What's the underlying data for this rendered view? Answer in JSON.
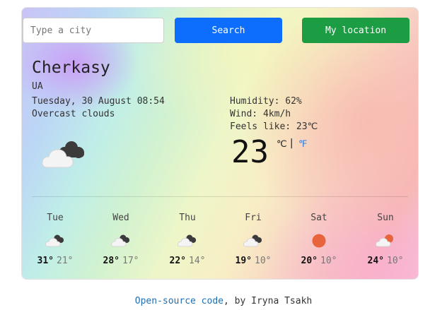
{
  "search": {
    "placeholder": "Type a city",
    "value": "",
    "search_label": "Search",
    "location_label": "My location"
  },
  "current": {
    "city": "Cherkasy",
    "country": "UA",
    "datetime": "Tuesday, 30 August 08:54",
    "description": "Overcast clouds",
    "icon": "overcast-clouds-icon",
    "humidity": "Humidity: 62%",
    "wind": "Wind: 4km/h",
    "feels_like": "Feels like: 23℃",
    "temperature": "23",
    "unit_celsius": "℃",
    "unit_separator": "|",
    "unit_fahrenheit": "℉"
  },
  "forecast": [
    {
      "day": "Tue",
      "max": "31°",
      "min": "21°",
      "icon": "broken-clouds-icon"
    },
    {
      "day": "Wed",
      "max": "28°",
      "min": "17°",
      "icon": "broken-clouds-icon"
    },
    {
      "day": "Thu",
      "max": "22°",
      "min": "14°",
      "icon": "broken-clouds-icon"
    },
    {
      "day": "Fri",
      "max": "19°",
      "min": "10°",
      "icon": "broken-clouds-icon"
    },
    {
      "day": "Sat",
      "max": "20°",
      "min": "10°",
      "icon": "sun-icon"
    },
    {
      "day": "Sun",
      "max": "24°",
      "min": "10°",
      "icon": "sun-behind-cloud-icon"
    }
  ],
  "footer": {
    "link_text": "Open-source code",
    "by_text": ", by Iryna Tsakh"
  },
  "colors": {
    "search_button": "#0d6efd",
    "location_button": "#1c9d43",
    "link": "#1f6fb2",
    "sun": "#e8643c"
  }
}
